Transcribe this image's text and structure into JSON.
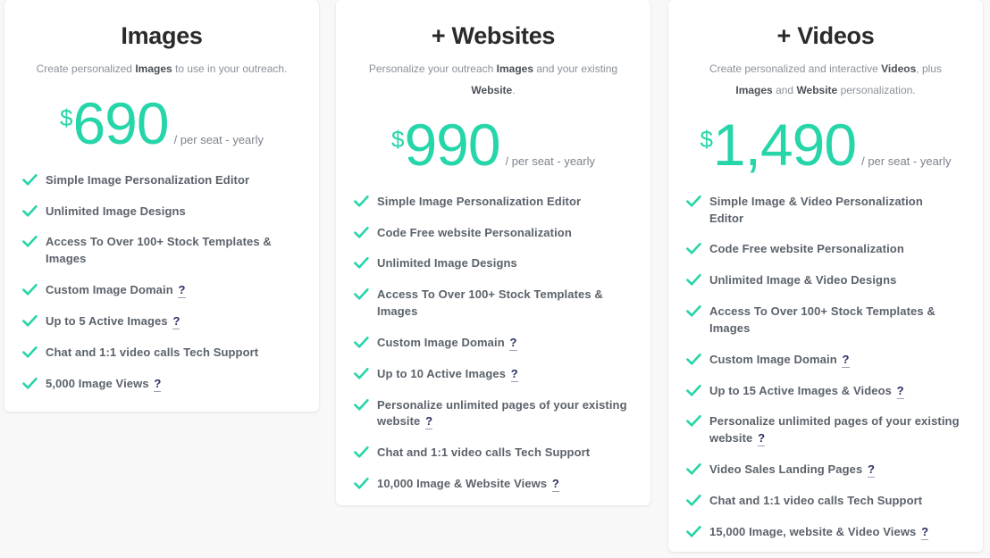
{
  "theme": {
    "accent_teal": "#26d5a8",
    "help_mark_color": "#2b2f63",
    "page_background": "#f8f8f8",
    "card_background": "#ffffff",
    "title_color": "#2a2a2a",
    "feature_text_color": "#5b626b"
  },
  "icons": {
    "check": "check-icon",
    "help": "question-mark-icon"
  },
  "help_label": "?",
  "plans": [
    {
      "title": "Images",
      "subtitle_parts": [
        {
          "text": "Create personalized ",
          "bold": false
        },
        {
          "text": "Images",
          "bold": true
        },
        {
          "text": " to use in your outreach.",
          "bold": false
        }
      ],
      "currency": "$",
      "amount": "690",
      "period": "/ per seat - yearly",
      "features": [
        {
          "text": "Simple Image Personalization Editor",
          "help": false
        },
        {
          "text": "Unlimited Image Designs",
          "help": false
        },
        {
          "text": "Access To Over 100+ Stock Templates & Images",
          "help": false
        },
        {
          "text": "Custom Image Domain",
          "help": true
        },
        {
          "text": "Up to 5 Active Images",
          "help": true
        },
        {
          "text": "Chat and 1:1 video calls Tech Support",
          "help": false
        },
        {
          "text": "5,000 Image Views",
          "help": true
        }
      ]
    },
    {
      "title": "+ Websites",
      "subtitle_parts": [
        {
          "text": "Personalize your outreach ",
          "bold": false
        },
        {
          "text": "Images",
          "bold": true
        },
        {
          "text": " and your existing ",
          "bold": false
        },
        {
          "text": "Website",
          "bold": true
        },
        {
          "text": ".",
          "bold": false
        }
      ],
      "currency": "$",
      "amount": "990",
      "period": "/ per seat - yearly",
      "features": [
        {
          "text": "Simple Image Personalization Editor",
          "help": false
        },
        {
          "text": "Code Free website Personalization",
          "help": false
        },
        {
          "text": "Unlimited Image Designs",
          "help": false
        },
        {
          "text": "Access To Over 100+ Stock Templates & Images",
          "help": false
        },
        {
          "text": "Custom Image Domain",
          "help": true
        },
        {
          "text": "Up to 10 Active Images",
          "help": true
        },
        {
          "text": "Personalize unlimited pages of your existing website",
          "help": true
        },
        {
          "text": "Chat and 1:1 video calls Tech Support",
          "help": false
        },
        {
          "text": "10,000 Image & Website Views",
          "help": true
        }
      ]
    },
    {
      "title": "+ Videos",
      "subtitle_parts": [
        {
          "text": "Create personalized and interactive ",
          "bold": false
        },
        {
          "text": "Videos",
          "bold": true
        },
        {
          "text": ", plus ",
          "bold": false
        },
        {
          "text": "Images",
          "bold": true
        },
        {
          "text": " and ",
          "bold": false
        },
        {
          "text": "Website",
          "bold": true
        },
        {
          "text": " personalization.",
          "bold": false
        }
      ],
      "currency": "$",
      "amount": "1,490",
      "period": "/ per seat - yearly",
      "features": [
        {
          "text": "Simple Image & Video Personalization Editor",
          "help": false
        },
        {
          "text": "Code Free website Personalization",
          "help": false
        },
        {
          "text": "Unlimited Image & Video Designs",
          "help": false
        },
        {
          "text": "Access To Over 100+ Stock Templates & Images",
          "help": false
        },
        {
          "text": "Custom Image Domain",
          "help": true
        },
        {
          "text": "Up to 15 Active Images & Videos",
          "help": true
        },
        {
          "text": "Personalize unlimited pages of your existing website",
          "help": true
        },
        {
          "text": "Video Sales Landing Pages",
          "help": true
        },
        {
          "text": "Chat and 1:1 video calls Tech Support",
          "help": false
        },
        {
          "text": "15,000 Image, website & Video Views",
          "help": true
        }
      ]
    }
  ]
}
